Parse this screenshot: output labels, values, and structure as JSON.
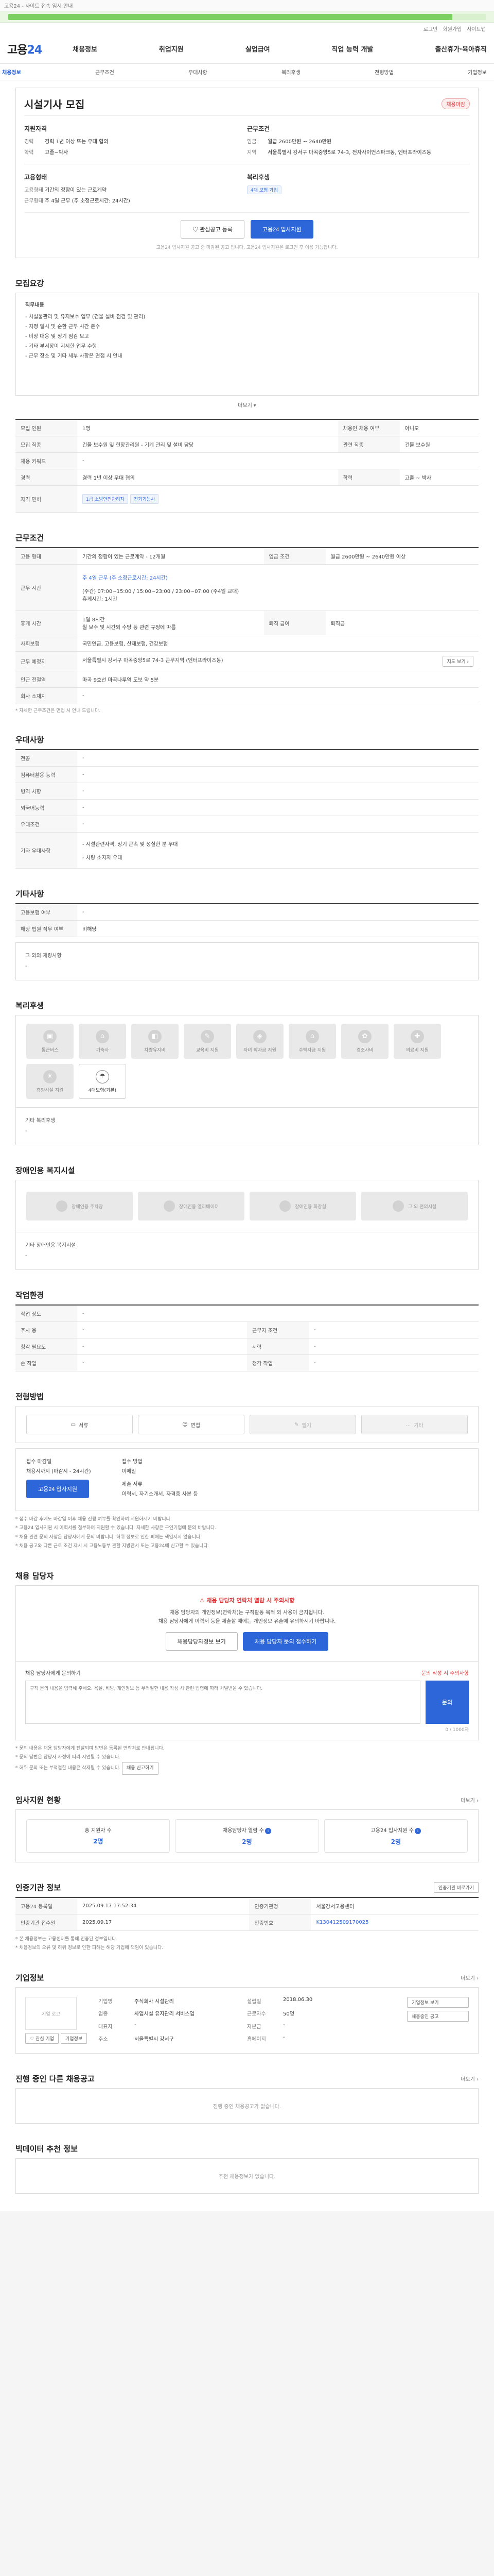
{
  "topbar": {
    "text": "고용24 - 사이트 접속 임시 안내",
    "progress_pct": 0.93
  },
  "util": [
    "로그인",
    "회원가입",
    "사이트맵"
  ],
  "header": {
    "logo_prefix": "고용",
    "logo_suffix": "24",
    "menu": [
      "채용정보",
      "취업지원",
      "실업급여",
      "직업 능력 개발",
      "출산휴가·육아휴직"
    ]
  },
  "subnav": {
    "items": [
      "채용정보",
      "근무조건",
      "우대사항",
      "복리후생",
      "전형방법",
      "기업정보"
    ]
  },
  "job": {
    "title": "시설기사 모집",
    "status_badge": "채용마감",
    "recruit": {
      "heading": "지원자격",
      "rows": [
        {
          "k": "경력",
          "v": "경력 1년 이상 또는 우대 협의"
        },
        {
          "k": "학력",
          "v": "고졸~박사"
        }
      ]
    },
    "conditions": {
      "heading": "근무조건",
      "rows": [
        {
          "k": "임금",
          "v": "월급 2600만원 ~ 2640만원"
        },
        {
          "k": "지역",
          "v": "서울특별시 강서구 마곡중앙5로 74-3, 전자사이언스파크동, 엔터프라이즈동"
        }
      ]
    },
    "employ": {
      "heading": "고용형태",
      "rows": [
        {
          "k": "고용형태",
          "v": "기간의 정함이 있는 근로계약"
        },
        {
          "k": "근무형태",
          "v": "주 4일 근무 (주 소정근로시간: 24시간)"
        }
      ]
    },
    "welfare": {
      "heading": "복리후생",
      "tag": "4대 보험 가입"
    },
    "btn_interest": "관심공고 등록",
    "btn_apply": "고용24 입사지원",
    "note": "고용24 입사지원 공고 중 마감된 공고 입니다. 고용24 입사지원은 로그인 후 이용 가능합니다."
  },
  "description": {
    "title": "모집요강",
    "head": "직무내용",
    "lines": [
      "- 시설물관리 및 유지보수 업무 (건물 설비 점검 및 관리)",
      "- 지정 일시 및 순환 근무 시간 준수",
      "- 비상 대응 및 정기 점검 보고",
      "- 기타 부서장이 지시한 업무 수행",
      "- 근무 장소 및 기타 세부 사항은 면접 시 안내"
    ],
    "more": "더보기"
  },
  "recruit_table": {
    "rows": [
      {
        "k": "모집 인원",
        "v": "1명",
        "k2": "채용인 채용 여부",
        "v2": "아니오"
      },
      {
        "k": "모집 직종",
        "v": "건물 보수원 및 현장관리원 - 기계 관리 및 설비 담당",
        "k2": "관련 직종",
        "v2": "건물 보수원"
      },
      {
        "k": "채용 키워드",
        "v": "-",
        "k2": "",
        "v2": ""
      },
      {
        "k": "경력",
        "v": "경력 1년 이상 우대 협의",
        "k2": "학력",
        "v2": "고졸 ~ 박사"
      },
      {
        "k": "자격 면허",
        "v": "",
        "k2": "",
        "v2": ""
      }
    ],
    "licenses": [
      "1급 소방안전관리자",
      "전기기능사"
    ]
  },
  "work": {
    "title": "근무조건",
    "rows": [
      {
        "k": "고용 형태",
        "v": "기간의 정함이 있는 근로계약 - 12개월",
        "k2": "임금 조건",
        "v2": "월급 2600만원 ~ 2640만원 이상"
      },
      {
        "k": "근무 시간",
        "v": "주 4일 근무 (주 소정근로시간: 24시간)",
        "k2": "",
        "v2": ""
      },
      {
        "k": "휴게 시간",
        "v": "1일 8시간",
        "k2": "퇴직 급여",
        "v2": "퇴직금"
      },
      {
        "k": "사회보험",
        "v": "국민연금, 고용보험, 산재보험, 건강보험",
        "k2": "",
        "v2": ""
      },
      {
        "k": "근무 예정지",
        "v": "서울특별시 강서구 마곡중앙5로 74-3 근무지역 (엔터프라이즈동)",
        "k2": "",
        "v2": ""
      },
      {
        "k": "인근 전철역",
        "v": "마곡 9호선 마곡나루역 도보 약 5분",
        "k2": "",
        "v2": ""
      },
      {
        "k": "회사 소재지",
        "v": "-",
        "k2": "",
        "v2": ""
      }
    ],
    "time_detail": "(주간) 07:00~15:00 / 15:00~23:00 / 23:00~07:00 (주4일 교대)",
    "break_time": "휴게시간: 1시간",
    "benefit_detail": "월 보수 및 시간외 수당 등 관련 규정에 따름",
    "map_btn": "지도 보기",
    "note": "* 자세한 근무조건은 면접 시 안내 드립니다."
  },
  "prefer": {
    "title": "우대사항",
    "rows": [
      {
        "k": "전공",
        "v": "-"
      },
      {
        "k": "컴퓨터활용 능력",
        "v": "-"
      },
      {
        "k": "병역 사항",
        "v": "-"
      },
      {
        "k": "외국어능력",
        "v": "-"
      },
      {
        "k": "우대조건",
        "v": "-"
      },
      {
        "k": "기타 우대사항",
        "v": "- 시설관련자격, 장기 근속 및 성실한 분 우대"
      }
    ],
    "prefer_extra": "- 차량 소지자 우대"
  },
  "other": {
    "title": "기타사항",
    "rows": [
      {
        "k": "고용보험 여부",
        "v": "-"
      },
      {
        "k": "해당 법원 직무 여부",
        "v": "비해당"
      }
    ],
    "extra_title": "그 외의 재량사항",
    "extra_value": "-"
  },
  "benefits": {
    "title": "복리후생",
    "items": [
      {
        "name": "통근버스",
        "icon": "bus-icon",
        "on": false
      },
      {
        "name": "기숙사",
        "icon": "dormitory-icon",
        "on": false
      },
      {
        "name": "차량유지비",
        "icon": "car-icon",
        "on": false
      },
      {
        "name": "교육비 지원",
        "icon": "education-icon",
        "on": false
      },
      {
        "name": "자녀 학자금 지원",
        "icon": "scholarship-icon",
        "on": false
      },
      {
        "name": "주택자금 지원",
        "icon": "house-icon",
        "on": false
      },
      {
        "name": "경조사비",
        "icon": "event-icon",
        "on": false
      },
      {
        "name": "의료비 지원",
        "icon": "medical-icon",
        "on": false
      },
      {
        "name": "휴양시설 지원",
        "icon": "resort-icon",
        "on": false
      },
      {
        "name": "4대보험(기본)",
        "icon": "insurance-icon",
        "on": true
      }
    ],
    "etc_label": "기타 복리후생",
    "etc_value": "-"
  },
  "disability": {
    "title": "장애인용 복지시설",
    "items": [
      "장애인용 주차장",
      "장애인용 엘리베이터",
      "장애인용 화장실",
      "그 외 편의시설"
    ],
    "etc_label": "기타 장애인용 복지시설",
    "etc_value": "-"
  },
  "env": {
    "title": "작업환경",
    "rows": [
      {
        "k": "작업 정도",
        "v": "-",
        "k2": "",
        "v2": ""
      },
      {
        "k": "주사 용",
        "v": "-",
        "k2": "근무지 조건",
        "v2": "-"
      },
      {
        "k": "청각 필요도",
        "v": "-",
        "k2": "시력",
        "v2": "-"
      },
      {
        "k": "손 작업",
        "v": "-",
        "k2": "청각 작업",
        "v2": "-"
      }
    ]
  },
  "selection": {
    "title": "전형방법",
    "steps": [
      {
        "name": "서류",
        "icon": "document-icon",
        "dim": false
      },
      {
        "name": "면접",
        "icon": "interview-icon",
        "dim": false
      },
      {
        "name": "필기",
        "icon": "pencil-icon",
        "dim": true
      },
      {
        "name": "기타",
        "icon": "etc-icon",
        "dim": true
      }
    ],
    "deadline_label": "접수 마감일",
    "deadline_value": "채용시까지 (마감시 - 24시간)",
    "method_label": "접수 방법",
    "method_value": "이메일",
    "docs_label": "제출 서류",
    "docs_value": "이력서, 자기소개서, 자격증 사본 등",
    "apply_btn": "고용24 입사지원",
    "notes": [
      "* 접수 마감 후에도 마감일 이후 채용 진행 여부를 확인하여 지원하시기 바랍니다.",
      "* 고용24 입사지원 시 이력서를 첨부하여 지원할 수 있습니다. 자세한 사항은 구인기업에 문의 바랍니다.",
      "* 채용 관련 문의 사항은 담당자에게 문의 바랍니다. 허위 정보로 인한 피해는 책임지지 않습니다.",
      "* 채용 공고와 다른 근로 조건 제시 시 고용노동부 관할 지방관서 또는 고용24에 신고할 수 있습니다."
    ]
  },
  "contact": {
    "title": "채용 담당자",
    "alert": "채용 담당자 연락처 열람 시 주의사항",
    "p1": "채용 담당자의 개인정보(연락처)는 구직활동 목적 외 사용이 금지됩니다.",
    "p2": "채용 담당자에게 이력서 등을 제출할 때에는 개인정보 유출에 유의하시기 바랍니다.",
    "btn_left": "채용담당자정보 보기",
    "btn_right": "채용 담당자 문의 접수하기",
    "inquiry_title": "채용 담당자에게 문의하기",
    "inquiry_link": "문의 작성 시 주의사항",
    "placeholder": "구직 문의 내용을 입력해 주세요. 욕설, 비방, 개인정보 등 부적절한 내용 작성 시 관련 법령에 따라 처벌받을 수 있습니다.",
    "submit": "문의",
    "counter": "0 / 1000자",
    "notes": [
      "* 문의 내용은 채용 담당자에게 전달되며 답변은 등록된 연락처로 안내됩니다.",
      "* 문의 답변은 담당자 사정에 따라 지연될 수 있습니다.",
      "* 허위 문의 또는 부적절한 내용은 삭제될 수 있습니다."
    ],
    "report_btn": "채용 신고하기"
  },
  "stats": {
    "title": "입사지원 현황",
    "link": "더보기",
    "items": [
      {
        "label": "총 지원자 수",
        "num": "2명"
      },
      {
        "label": "채용담당자 열람 수",
        "num": "2명"
      },
      {
        "label": "고용24 입사지원 수",
        "num": "2명"
      }
    ]
  },
  "agency": {
    "title": "인증기관 정보",
    "link": "인증기관 바로가기",
    "rows": [
      {
        "k": "고용24 등록일",
        "v": "2025.09.17 17:52:34",
        "k2": "인증기관명",
        "v2": "서울강서고용센터"
      },
      {
        "k": "인증기관 접수일",
        "v": "2025.09.17",
        "k2": "인증번호",
        "v2": "K130412509170025"
      }
    ],
    "notes": [
      "* 본 채용정보는 고용센터를 통해 인증된 정보입니다.",
      "* 채용정보의 오류 및 허위 정보로 인한 피해는 해당 기업에 책임이 있습니다."
    ]
  },
  "company": {
    "title": "기업정보",
    "link": "더보기",
    "logo_alt": "기업 로고",
    "btn_a": "관심 기업",
    "btn_b": "기업정보",
    "info": [
      {
        "k": "기업명",
        "v": "주식회사 시설관리"
      },
      {
        "k": "업종",
        "v": "사업시설 유지관리 서비스업"
      },
      {
        "k": "대표자",
        "v": "-"
      },
      {
        "k": "설립일",
        "v": "2018.06.30"
      },
      {
        "k": "주소",
        "v": "서울특별시 강서구"
      },
      {
        "k": "근로자수",
        "v": "50명"
      },
      {
        "k": "홈페이지",
        "v": "-"
      },
      {
        "k": "자본금",
        "v": "-"
      }
    ],
    "side_btns": [
      "기업정보 보기",
      "채용중인 공고"
    ]
  },
  "other_jobs": {
    "title": "진행 중인 다른 채용공고",
    "link": "더보기",
    "empty": "진행 중인 채용공고가 없습니다."
  },
  "recommend": {
    "title": "빅데이터 추천 정보",
    "empty": "추천 채용정보가 없습니다."
  }
}
